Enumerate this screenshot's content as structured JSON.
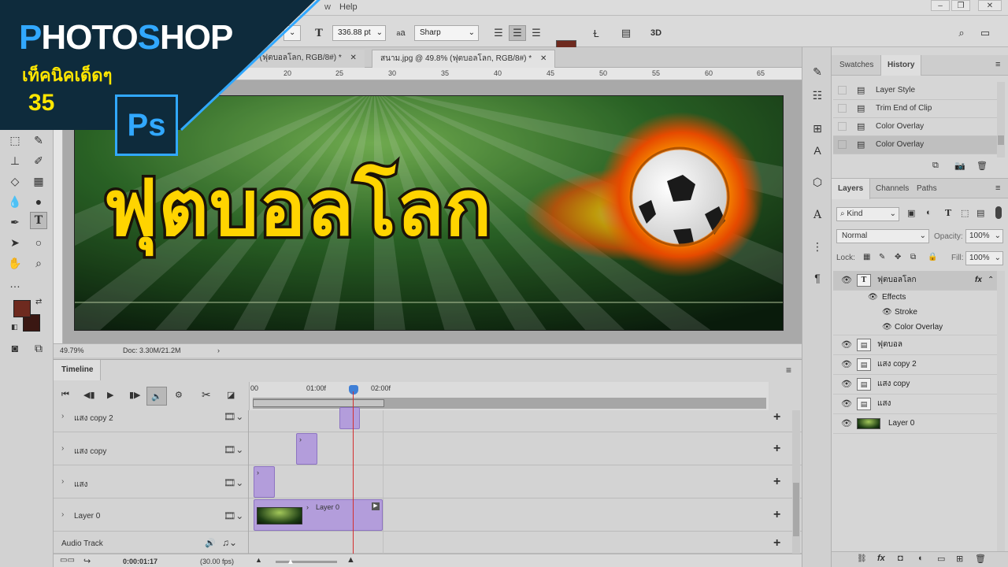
{
  "menu": {
    "help_label": "Help",
    "partial_item": "w"
  },
  "options": {
    "font_size": "336.88 pt",
    "aa_icon_text": "a",
    "antialias": "Sharp"
  },
  "tabs": [
    {
      "label": "% (ฟุตบอลโลก, RGB/8#) *"
    },
    {
      "label": "สนาม.jpg @ 49.8% (ฟุตบอลโลก, RGB/8#) *"
    }
  ],
  "ruler_numbers": [
    "20",
    "25",
    "30",
    "35",
    "40",
    "45",
    "50",
    "55",
    "60",
    "65"
  ],
  "document": {
    "headline": "ฟุตบอลโลก"
  },
  "status": {
    "zoom": "49.79%",
    "doc_size": "Doc: 3.30M/21.2M"
  },
  "timeline": {
    "title": "Timeline",
    "time_marks": [
      "00",
      "01:00f",
      "02:00f"
    ],
    "rows": [
      {
        "label": "แสง copy 2"
      },
      {
        "label": "แสง copy"
      },
      {
        "label": "แสง"
      },
      {
        "label": "Layer 0",
        "clip_label": "Layer 0"
      }
    ],
    "audio_track": "Audio Track",
    "current_time": "0:00:01:17",
    "fps": "(30.00 fps)"
  },
  "history_panel": {
    "tabs": [
      "Swatches",
      "History"
    ],
    "items": [
      "Layer Style",
      "Trim End of Clip",
      "Color Overlay",
      "Color Overlay"
    ]
  },
  "layers_panel": {
    "tabs": [
      "Layers",
      "Channels",
      "Paths"
    ],
    "filter": "Kind",
    "blend_mode": "Normal",
    "opacity_label": "Opacity:",
    "opacity": "100%",
    "lock_label": "Lock:",
    "fill_label": "Fill:",
    "fill": "100%",
    "fx_label": "fx",
    "layers": [
      {
        "name": "ฟุตบอลโลก",
        "type": "text"
      },
      {
        "name": "Effects",
        "type": "effects"
      },
      {
        "name": "Stroke",
        "type": "effect"
      },
      {
        "name": "Color Overlay",
        "type": "effect"
      },
      {
        "name": "ฟุตบอล",
        "type": "smart"
      },
      {
        "name": "แสง copy 2",
        "type": "smart"
      },
      {
        "name": "แสง copy",
        "type": "smart"
      },
      {
        "name": "แสง",
        "type": "smart"
      },
      {
        "name": "Layer 0",
        "type": "image"
      }
    ]
  },
  "branding": {
    "title_p": "P",
    "title_hoto": "HOTO",
    "title_s": "S",
    "title_hop": "HOP",
    "subtitle": "เท็คนิคเด็ดๆ",
    "number": "35",
    "ps_logo": "Ps"
  },
  "colors": {
    "foreground": "#6e2a1f",
    "background": "#3a1712",
    "brand_dark": "#0e2b3c",
    "brand_blue": "#31a8ff",
    "brand_yellow": "#ffe600",
    "clip_purple": "#b39ddb",
    "playhead": "#d32f2f",
    "headline_yellow": "#ffd400"
  }
}
